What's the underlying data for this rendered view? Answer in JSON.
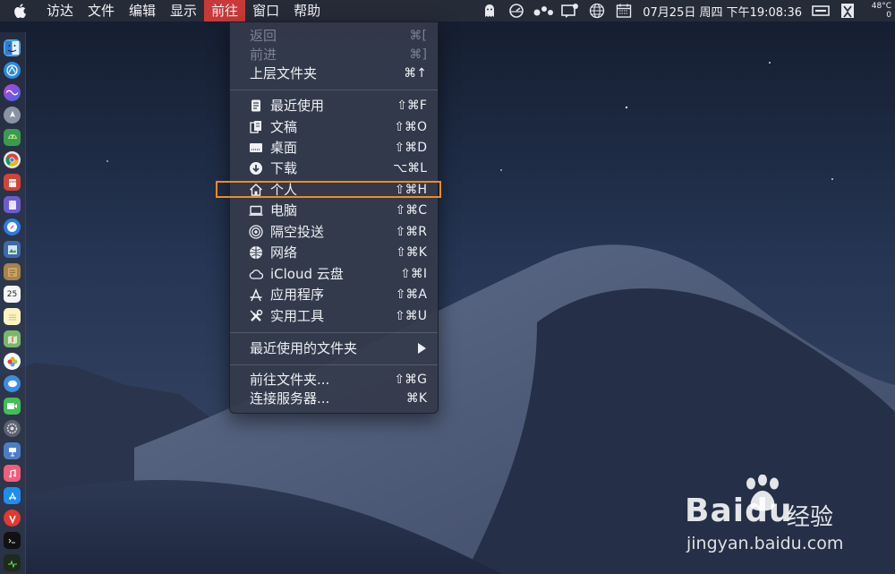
{
  "menubar": {
    "apple_icon": "apple-icon",
    "items": [
      {
        "label": "访达"
      },
      {
        "label": "文件"
      },
      {
        "label": "编辑"
      },
      {
        "label": "显示"
      },
      {
        "label": "前往",
        "active": true
      },
      {
        "label": "窗口"
      },
      {
        "label": "帮助"
      }
    ],
    "status": {
      "clock": "07月25日 周四 下午19:08:36",
      "temp_line1": "48°C",
      "temp_line2": "0"
    }
  },
  "go_menu": {
    "items": [
      {
        "label": "返回",
        "shortcut": "⌘[",
        "disabled": true
      },
      {
        "label": "前进",
        "shortcut": "⌘]",
        "disabled": true
      },
      {
        "label": "上层文件夹",
        "shortcut": "⌘↑"
      },
      {
        "label": "最近使用",
        "shortcut": "⇧⌘F",
        "icon": "recents-icon"
      },
      {
        "label": "文稿",
        "shortcut": "⇧⌘O",
        "icon": "documents-icon"
      },
      {
        "label": "桌面",
        "shortcut": "⇧⌘D",
        "icon": "desktop-icon"
      },
      {
        "label": "下载",
        "shortcut": "⌥⌘L",
        "icon": "downloads-icon"
      },
      {
        "label": "个人",
        "shortcut": "⇧⌘H",
        "icon": "home-icon"
      },
      {
        "label": "电脑",
        "shortcut": "⇧⌘C",
        "icon": "computer-icon"
      },
      {
        "label": "隔空投送",
        "shortcut": "⇧⌘R",
        "icon": "airdrop-icon"
      },
      {
        "label": "网络",
        "shortcut": "⇧⌘K",
        "icon": "network-icon"
      },
      {
        "label": "iCloud 云盘",
        "shortcut": "⇧⌘I",
        "icon": "icloud-icon"
      },
      {
        "label": "应用程序",
        "shortcut": "⇧⌘A",
        "icon": "applications-icon"
      },
      {
        "label": "实用工具",
        "shortcut": "⇧⌘U",
        "icon": "utilities-icon"
      },
      {
        "label": "最近使用的文件夹",
        "submenu": true
      },
      {
        "label": "前往文件夹...",
        "shortcut": "⇧⌘G"
      },
      {
        "label": "连接服务器...",
        "shortcut": "⌘K"
      }
    ]
  },
  "dock": {
    "calendar_day": "25"
  },
  "watermark": {
    "brand": "Baidu",
    "sub": "经验",
    "url": "jingyan.baidu.com"
  },
  "colors": {
    "active_menu": "#c83a3a",
    "highlight_box": "#f08a24"
  }
}
